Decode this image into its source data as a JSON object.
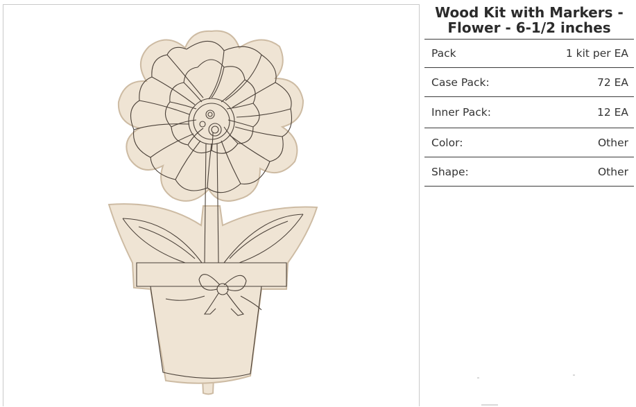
{
  "product": {
    "title": "Wood Kit with Markers - Flower - 6-1/2 inches",
    "image_subject": "flower-pot-wood-cutout"
  },
  "specs": [
    {
      "label": "Pack",
      "value": "1 kit per EA"
    },
    {
      "label": "Case Pack:",
      "value": "72 EA"
    },
    {
      "label": "Inner Pack:",
      "value": "12 EA"
    },
    {
      "label": "Color:",
      "value": "Other"
    },
    {
      "label": "Shape:",
      "value": "Other"
    }
  ],
  "colors": {
    "wood": "#efe4d4",
    "wood_edge": "#cdbba3",
    "line": "#4a4038",
    "divider": "#3a3a3a"
  }
}
